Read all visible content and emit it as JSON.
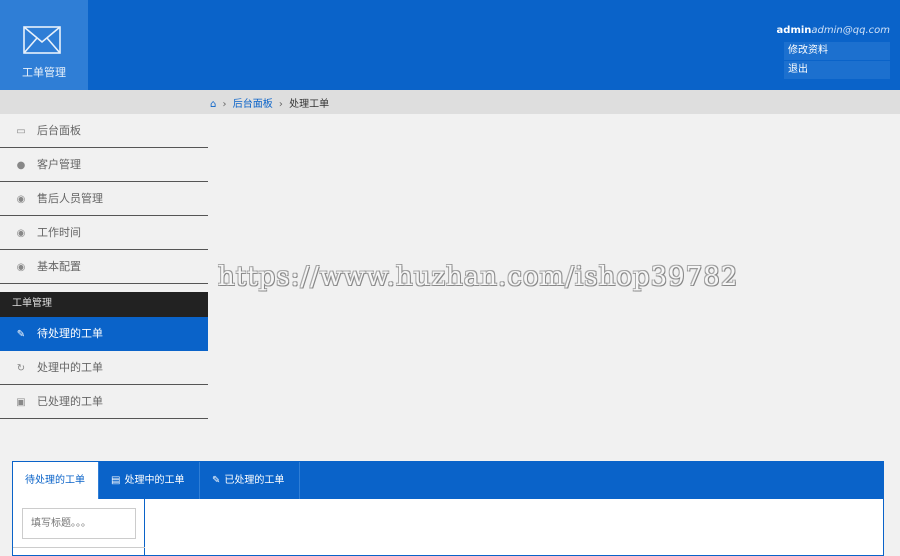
{
  "header": {
    "logo_label": "工单管理",
    "user_name": "admin",
    "user_email": "admin@qq.com",
    "menu": [
      "修改资料",
      "退出"
    ]
  },
  "breadcrumb": {
    "home_icon": "home-icon",
    "items": [
      "后台面板",
      "处理工单"
    ]
  },
  "sidebar": {
    "items": [
      {
        "label": "后台面板",
        "icon": "laptop-icon"
      },
      {
        "label": "客户管理",
        "icon": "user-icon"
      },
      {
        "label": "售后人员管理",
        "icon": "comments-icon"
      },
      {
        "label": "工作时间",
        "icon": "comments-icon"
      },
      {
        "label": "基本配置",
        "icon": "comments-icon"
      }
    ],
    "section_title": "工单管理",
    "section_items": [
      {
        "label": "待处理的工单",
        "icon": "pencil-icon",
        "active": true
      },
      {
        "label": "处理中的工单",
        "icon": "refresh-icon"
      },
      {
        "label": "已处理的工单",
        "icon": "briefcase-icon"
      }
    ]
  },
  "watermark": "https://www.huzhan.com/ishop39782",
  "panel": {
    "tabs": [
      {
        "label": "待处理的工单",
        "active": true
      },
      {
        "label": "处理中的工单",
        "icon": "inbox-icon"
      },
      {
        "label": "已处理的工单",
        "icon": "edit-icon"
      }
    ],
    "search_placeholder": "填写标题。。。"
  },
  "colors": {
    "primary": "#0a63c9",
    "logo_bg": "#2f7ed6",
    "section_bg": "#222222"
  }
}
